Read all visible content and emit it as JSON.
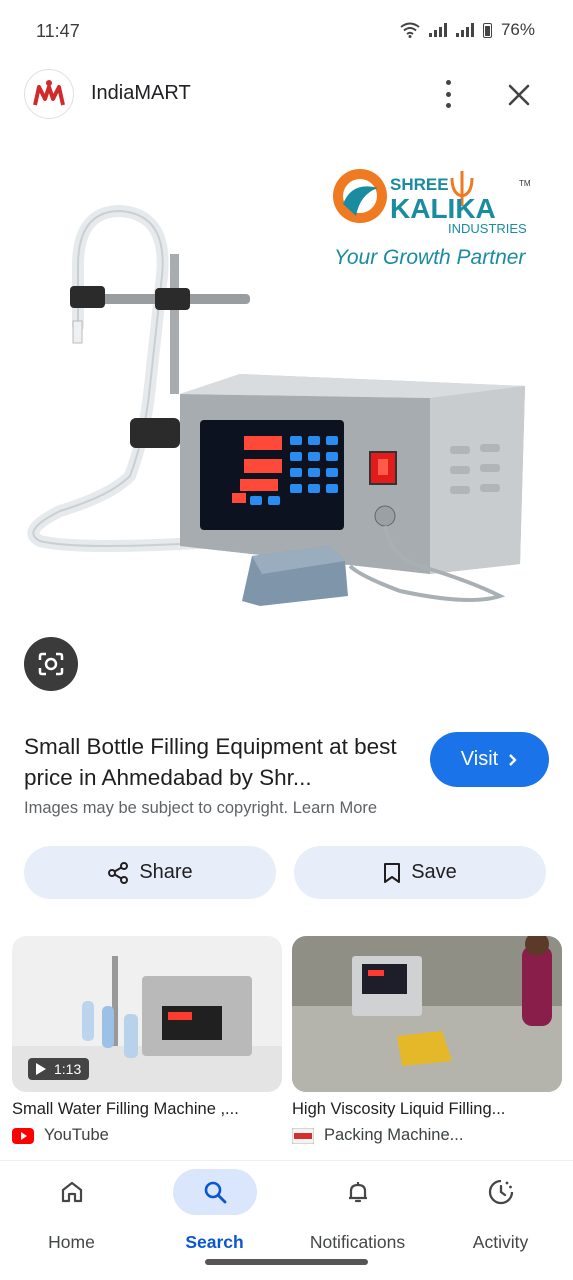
{
  "status_bar": {
    "time": "11:47",
    "battery": "76%"
  },
  "header": {
    "site_name": "IndiaMART"
  },
  "product_image": {
    "brand_line1": "SHREE",
    "brand_line2": "KALIKA",
    "brand_line3": "INDUSTRIES",
    "tm": "TM",
    "tagline": "Your Growth Partner"
  },
  "result": {
    "title": "Small Bottle Filling Equipment at best price in Ahmedabad by Shr...",
    "visit_label": "Visit",
    "copyright_text": "Images may be subject to copyright. Learn More"
  },
  "actions": {
    "share_label": "Share",
    "save_label": "Save"
  },
  "related": [
    {
      "title": "Small Water Filling Machine ,...",
      "source": "YouTube",
      "duration": "1:13",
      "icon": "youtube-icon"
    },
    {
      "title": "High Viscosity Liquid Filling...",
      "source": "Packing Machine...",
      "icon": "site-favicon"
    }
  ],
  "bottom_nav": [
    {
      "label": "Home",
      "icon": "home-icon",
      "active": false
    },
    {
      "label": "Search",
      "icon": "search-icon",
      "active": true
    },
    {
      "label": "Notifications",
      "icon": "bell-icon",
      "active": false
    },
    {
      "label": "Activity",
      "icon": "activity-icon",
      "active": false
    }
  ],
  "colors": {
    "accent": "#1a73e8",
    "button_bg": "#e8eef9",
    "active_nav": "#0b57d0",
    "brand_teal": "#1a8ca0",
    "brand_orange": "#f07a22"
  }
}
